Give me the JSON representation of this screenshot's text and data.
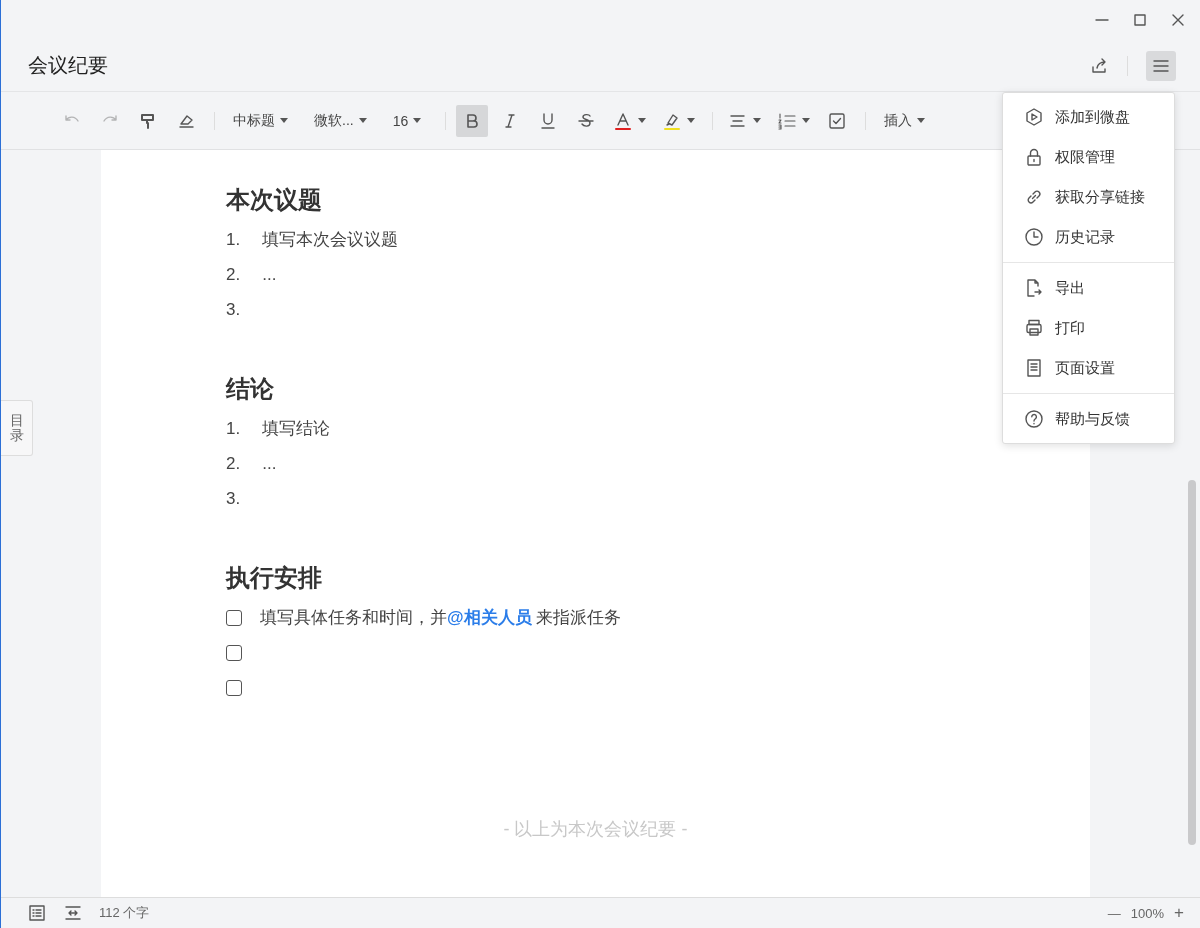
{
  "window": {
    "title": "会议纪要"
  },
  "toolbar": [
    {
      "kind": "undo",
      "disabled": true
    },
    {
      "kind": "redo",
      "disabled": true
    },
    {
      "kind": "painter",
      "disabled": false
    },
    {
      "kind": "eraser",
      "disabled": false
    },
    {
      "kind": "separator"
    },
    {
      "kind": "dropdown",
      "label": "中标题"
    },
    {
      "kind": "dropdown",
      "label": "微软..."
    },
    {
      "kind": "dropdown",
      "label": "16"
    },
    {
      "kind": "separator"
    },
    {
      "kind": "bold",
      "selected": true
    },
    {
      "kind": "italic",
      "selected": false
    },
    {
      "kind": "underline",
      "selected": false
    },
    {
      "kind": "strike",
      "selected": false
    },
    {
      "kind": "fontcolor",
      "selected": false
    },
    {
      "kind": "highlight",
      "selected": false
    },
    {
      "kind": "separator"
    },
    {
      "kind": "align",
      "selected": false
    },
    {
      "kind": "numbered",
      "selected": false
    },
    {
      "kind": "todo",
      "selected": false
    },
    {
      "kind": "separator"
    },
    {
      "kind": "dropdown",
      "label": "插入"
    }
  ],
  "outline_tab": {
    "label": "目录"
  },
  "document": {
    "sections": [
      {
        "heading": "本次议题",
        "kind": "numbered",
        "items": [
          {
            "number": "1.",
            "text": "填写本次会议议题"
          },
          {
            "number": "2.",
            "text": "..."
          },
          {
            "number": "3."
          }
        ]
      },
      {
        "heading": "结论",
        "kind": "numbered",
        "items": [
          {
            "number": "1.",
            "text": "填写结论"
          },
          {
            "number": "2.",
            "text": "..."
          },
          {
            "number": "3."
          }
        ]
      },
      {
        "heading": "执行安排",
        "kind": "checklist",
        "items": [
          {
            "checked": false,
            "text": "填写具体任务和时间，并**@相关人员** 来指派任务"
          },
          {
            "checked": false
          },
          {
            "checked": false
          }
        ]
      }
    ],
    "footer": "- 以上为本次会议纪要 -"
  },
  "menu": {
    "groups": [
      [
        {
          "kind": "disk",
          "label": "添加到微盘"
        },
        {
          "kind": "lock",
          "label": "权限管理"
        },
        {
          "kind": "link",
          "label": "获取分享链接"
        },
        {
          "kind": "clock",
          "label": "历史记录"
        }
      ],
      [
        {
          "kind": "export",
          "label": "导出"
        },
        {
          "kind": "print",
          "label": "打印"
        },
        {
          "kind": "page",
          "label": "页面设置"
        }
      ],
      [
        {
          "kind": "help",
          "label": "帮助与反馈"
        }
      ]
    ]
  },
  "status_bar": {
    "word_count": "112 个字",
    "zoom_out": "—",
    "zoom": "100%",
    "zoom_in": "+"
  }
}
